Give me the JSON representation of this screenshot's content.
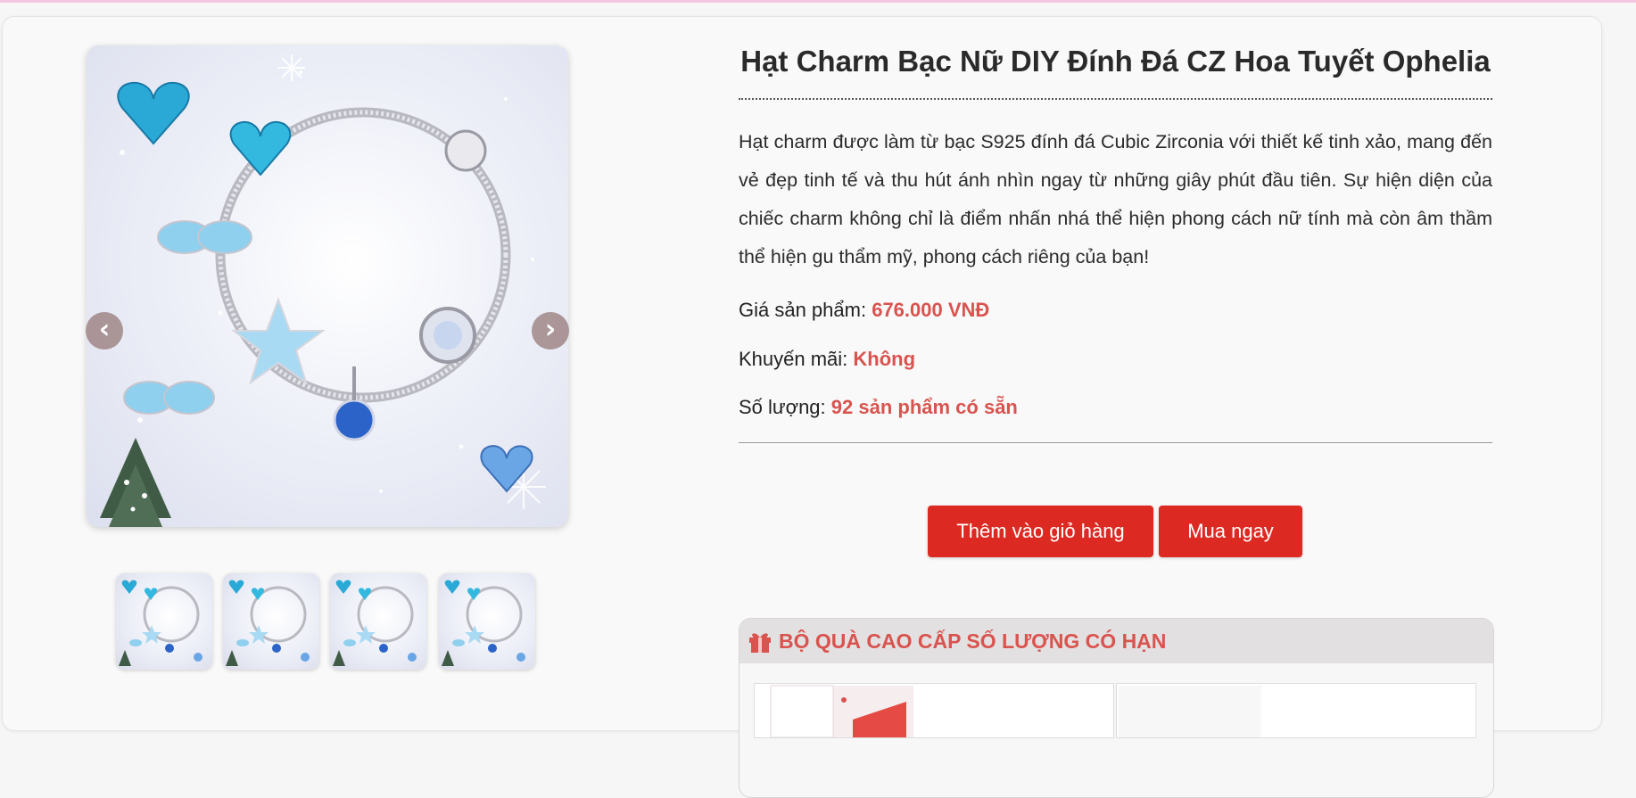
{
  "product": {
    "title": "Hạt Charm Bạc Nữ DIY Đính Đá CZ Hoa Tuyết Ophelia",
    "description": "Hạt charm được làm từ bạc S925 đính đá Cubic Zirconia với thiết kế tinh xảo, mang đến vẻ đẹp tinh tế và thu hút ánh nhìn ngay từ những giây phút đầu tiên. Sự hiện diện của chiếc charm không chỉ là điểm nhấn nhá thể hiện phong cách nữ tính mà còn âm thầm thể hiện gu thẩm mỹ, phong cách riêng của bạn!",
    "price_label": "Giá sản phẩm:",
    "price_value": "676.000 VNĐ",
    "promo_label": "Khuyến mãi:",
    "promo_value": "Không",
    "qty_label": "Số lượng:",
    "qty_value": "92 sản phẩm có sẵn"
  },
  "gallery": {
    "prev_icon": "chevron-left-icon",
    "next_icon": "chevron-right-icon",
    "prev_glyph": "‹",
    "next_glyph": "›",
    "thumb_count": 4,
    "accent_blue": "#2aa9d6"
  },
  "actions": {
    "add_to_cart": "Thêm vào giỏ hàng",
    "buy_now": "Mua ngay",
    "button_color": "#dc2a23"
  },
  "gift": {
    "icon": "gift-icon",
    "heading": "BỘ QUÀ CAO CẤP SỐ LƯỢNG CÓ HẠN",
    "accent": "#d9534f"
  }
}
